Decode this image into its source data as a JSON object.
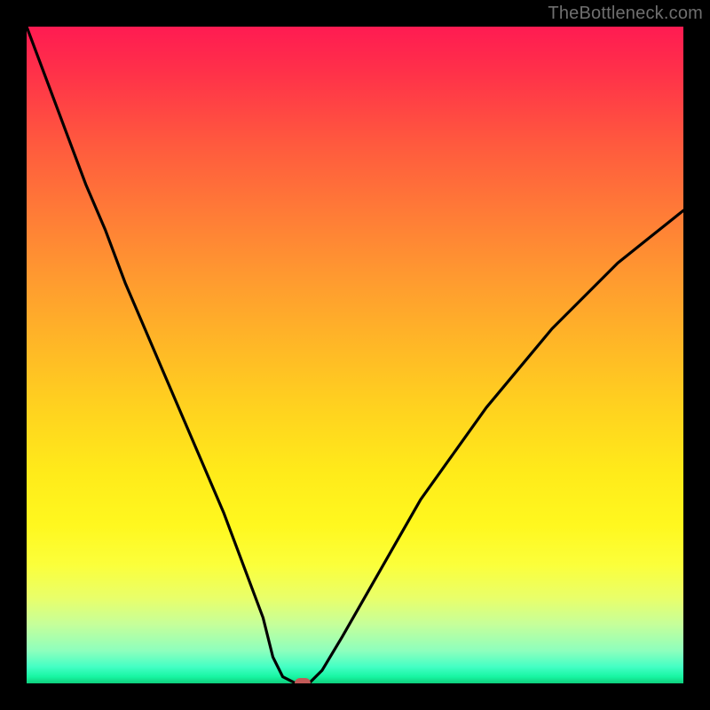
{
  "watermark": "TheBottleneck.com",
  "colors": {
    "background": "#000000",
    "curve_stroke": "#000000",
    "marker_fill": "#c25a58",
    "watermark_text": "#6f6f6f"
  },
  "chart_data": {
    "type": "line",
    "title": "",
    "xlabel": "",
    "ylabel": "",
    "xlim": [
      0,
      100
    ],
    "ylim": [
      0,
      100
    ],
    "series": [
      {
        "name": "bottleneck-curve",
        "x": [
          0,
          3,
          6,
          9,
          12,
          15,
          18,
          21,
          24,
          27,
          30,
          33,
          36,
          37.5,
          39,
          41,
          43,
          45,
          48,
          52,
          56,
          60,
          65,
          70,
          75,
          80,
          85,
          90,
          95,
          100
        ],
        "y": [
          100,
          92,
          84,
          76,
          69,
          61,
          54,
          47,
          40,
          33,
          26,
          18,
          10,
          4,
          1,
          0,
          0,
          2,
          7,
          14,
          21,
          28,
          35,
          42,
          48,
          54,
          59,
          64,
          68,
          72
        ]
      }
    ],
    "marker": {
      "x": 42,
      "y": 0
    },
    "gradient_stops": [
      {
        "pos": 0,
        "color": "#ff1b52"
      },
      {
        "pos": 0.5,
        "color": "#ffd21f"
      },
      {
        "pos": 0.88,
        "color": "#e9ff6a"
      },
      {
        "pos": 1.0,
        "color": "#0fce7d"
      }
    ]
  }
}
